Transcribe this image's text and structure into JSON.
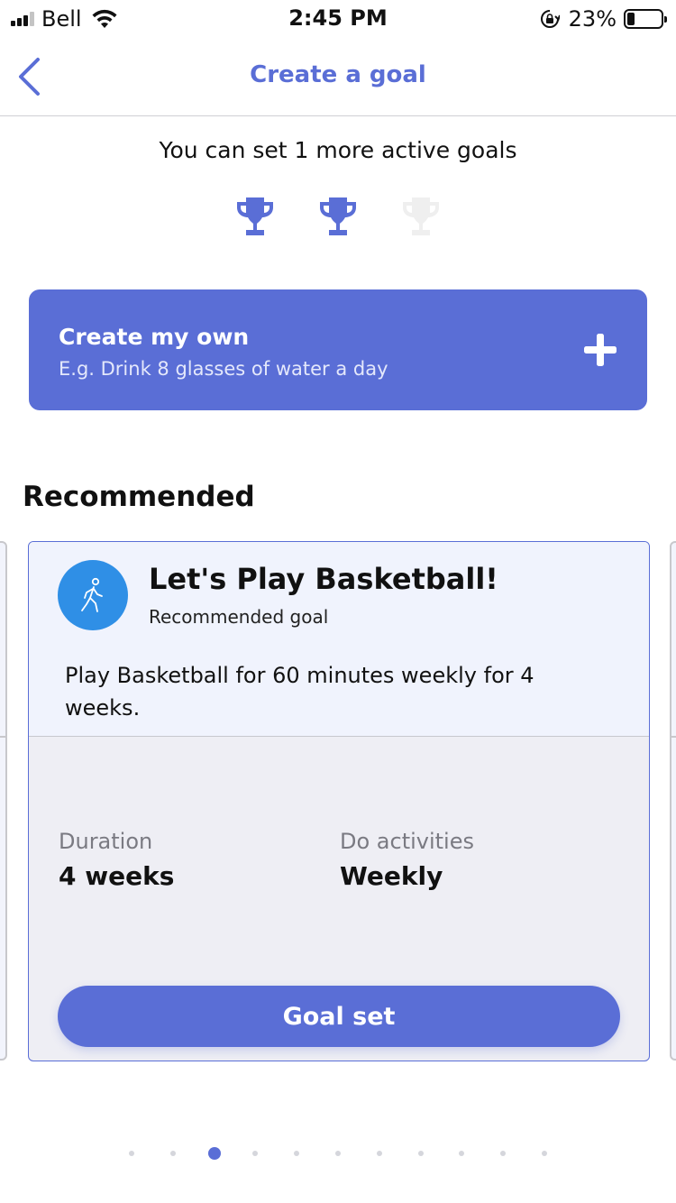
{
  "status_bar": {
    "carrier": "Bell",
    "time": "2:45 PM",
    "battery_percent": "23%",
    "battery_level": 0.23,
    "signal_bars_active": 3,
    "icons": [
      "signal-icon",
      "wifi-icon",
      "orientation-lock-icon",
      "battery-icon"
    ]
  },
  "nav": {
    "title": "Create a goal",
    "back_icon": "chevron-left-icon"
  },
  "goals_info": {
    "text": "You can set 1 more active goals",
    "trophies": [
      {
        "state": "active",
        "color": "#5a6ed6"
      },
      {
        "state": "active",
        "color": "#5a6ed6"
      },
      {
        "state": "available",
        "color": "#efefef"
      }
    ]
  },
  "create_card": {
    "title": "Create my own",
    "example": "E.g. Drink 8 glasses of water a day",
    "icon": "plus-icon"
  },
  "recommended": {
    "heading": "Recommended",
    "card": {
      "icon": "walking-icon",
      "title": "Let's Play Basketball!",
      "kind": "Recommended goal",
      "description": "Play Basketball for 60 minutes weekly for 4 weeks.",
      "duration_label": "Duration",
      "duration_value": "4 weeks",
      "frequency_label": "Do activities",
      "frequency_value": "Weekly",
      "button_label": "Goal set"
    }
  },
  "pagination": {
    "total": 11,
    "active_index": 2
  },
  "colors": {
    "accent": "#5a6ed6",
    "activity_icon_bg": "#2f8fe6",
    "card_top_bg": "#f0f3fd",
    "card_bottom_bg": "#eeeef4"
  }
}
